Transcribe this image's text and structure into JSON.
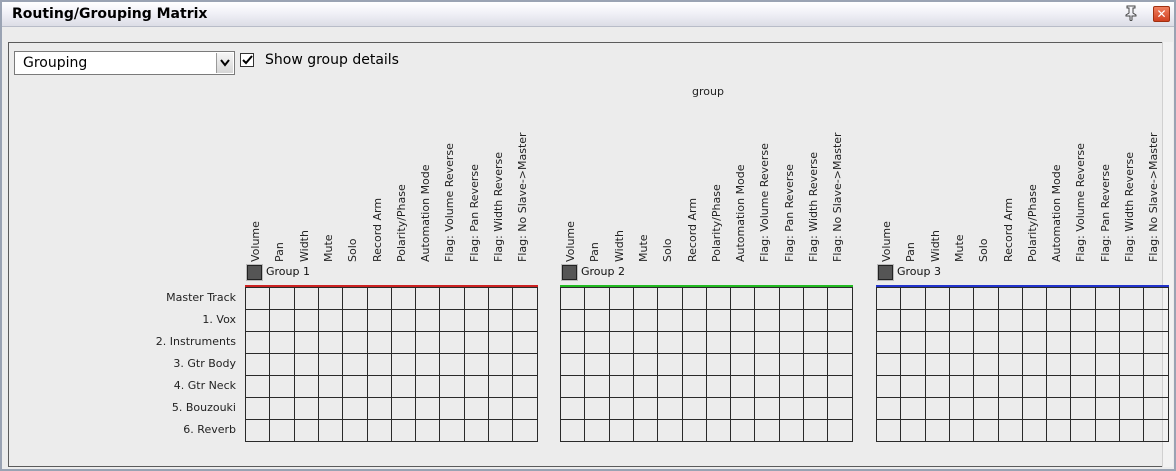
{
  "window": {
    "title": "Routing/Grouping Matrix",
    "pin_icon": "pin-icon",
    "close_icon": "close-icon"
  },
  "toolbar": {
    "mode_select": {
      "value": "Grouping"
    },
    "show_group_details": {
      "label": "Show group details",
      "checked": true
    }
  },
  "matrix": {
    "header_label": "group",
    "columns": [
      "Volume",
      "Pan",
      "Width",
      "Mute",
      "Solo",
      "Record Arm",
      "Polarity/Phase",
      "Automation Mode",
      "Flag: Volume Reverse",
      "Flag: Pan Reverse",
      "Flag: Width Reverse",
      "Flag: No Slave->Master"
    ],
    "groups": [
      {
        "name": "Group 1",
        "color": "#cc2222"
      },
      {
        "name": "Group 2",
        "color": "#22bb22"
      },
      {
        "name": "Group 3",
        "color": "#2233cc"
      }
    ],
    "tracks": [
      "Master Track",
      "1. Vox",
      "2. Instruments",
      "3. Gtr Body",
      "4. Gtr Neck",
      "5. Bouzouki",
      "6. Reverb"
    ]
  }
}
